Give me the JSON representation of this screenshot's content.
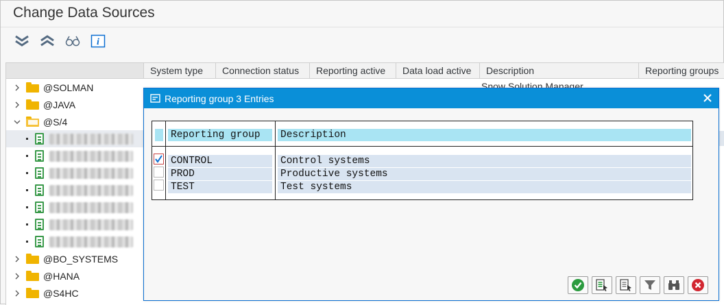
{
  "window": {
    "title": "Change Data Sources"
  },
  "toolbar": {
    "buttons": [
      {
        "name": "expand-all-icon"
      },
      {
        "name": "collapse-all-icon"
      },
      {
        "name": "display-glasses-icon"
      },
      {
        "name": "info-icon"
      }
    ]
  },
  "grid": {
    "columns": [
      "System type",
      "Connection status",
      "Reporting active",
      "Data load active",
      "Description",
      "Reporting groups"
    ],
    "peek_description": "Snow Solution Manager"
  },
  "tree": {
    "folders_top": [
      {
        "label": "@SOLMAN",
        "expanded": false
      },
      {
        "label": "@JAVA",
        "expanded": false
      },
      {
        "label": "@S/4",
        "expanded": true
      }
    ],
    "child_count": 7,
    "folders_bottom": [
      {
        "label": "@BO_SYSTEMS",
        "expanded": false
      },
      {
        "label": "@HANA",
        "expanded": false
      },
      {
        "label": "@S4HC",
        "expanded": false
      }
    ]
  },
  "dialog": {
    "title": "Reporting group 3 Entries",
    "table": {
      "headers": [
        "Reporting group",
        "Description"
      ],
      "rows": [
        {
          "group": "CONTROL",
          "description": "Control systems",
          "checked": true
        },
        {
          "group": "PROD",
          "description": "Productive systems",
          "checked": false
        },
        {
          "group": "TEST",
          "description": "Test systems",
          "checked": false
        }
      ]
    },
    "buttons": [
      "ok-icon",
      "select-all-icon",
      "deselect-icon",
      "filter-icon",
      "find-icon",
      "cancel-icon"
    ]
  },
  "colors": {
    "dialog_title_bg": "#0a8fd8",
    "header_row_bg": "#a9e4f3",
    "data_row_bg": "#d9e4f1",
    "folder": "#f0b400",
    "system_icon": "#3b9a4b",
    "ok_green": "#2b9b3f",
    "cancel_red": "#d22630"
  }
}
